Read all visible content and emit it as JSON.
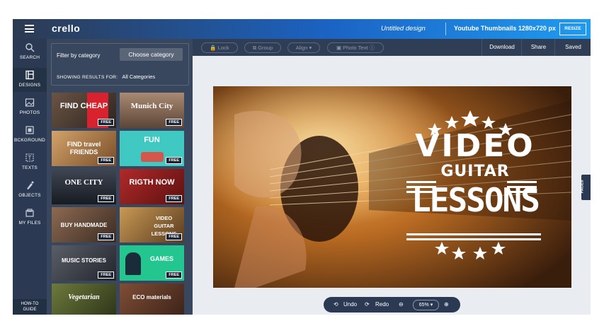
{
  "header": {
    "logo": "crello",
    "design_title": "Untitled design",
    "design_size": "Youtube Thumbnails 1280x720 px",
    "resize_label": "RESIZE"
  },
  "rail": [
    {
      "label": "SEARCH",
      "icon": "search-icon"
    },
    {
      "label": "DESIGNS",
      "icon": "designs-icon"
    },
    {
      "label": "PHOTOS",
      "icon": "photos-icon"
    },
    {
      "label": "BCKGROUND",
      "icon": "background-icon"
    },
    {
      "label": "TEXTS",
      "icon": "texts-icon"
    },
    {
      "label": "OBJECTS",
      "icon": "objects-icon"
    },
    {
      "label": "MY FILES",
      "icon": "files-icon"
    }
  ],
  "howto": {
    "line1": "HOW-TO",
    "line2": "GUIDE"
  },
  "panel": {
    "filter_label": "Filter by category",
    "choose_button": "Choose category",
    "showing_label": "SHOWING RESULTS FOR:",
    "showing_value": "All Categories"
  },
  "templates": [
    {
      "title": "FIND CHEAP",
      "badge": "FREE"
    },
    {
      "title": "Munich City",
      "badge": "FREE"
    },
    {
      "title": "FIND travel FRIENDS",
      "badge": "FREE"
    },
    {
      "title": "FUN",
      "badge": "FREE"
    },
    {
      "title": "ONE CITY",
      "badge": "FREE"
    },
    {
      "title": "RIGTH NOW",
      "badge": "FREE"
    },
    {
      "title": "BUY HANDMADE",
      "badge": "FREE"
    },
    {
      "title": "VIDEO GUITAR LESSONS",
      "badge": "FREE"
    },
    {
      "title": "MUSIC STORIES",
      "badge": "FREE"
    },
    {
      "title": "GAMES",
      "badge": "FREE"
    },
    {
      "title": "Vegetarian",
      "badge": ""
    },
    {
      "title": "ECO materials",
      "badge": ""
    }
  ],
  "toolbar": {
    "lock": "Lock",
    "group": "Group",
    "align": "Align",
    "photo_text": "Photo Text",
    "download": "Download",
    "share": "Share",
    "saved": "Saved"
  },
  "canvas": {
    "line1": "VIDEO",
    "line2": "GUITAR",
    "line3": "LESSONS"
  },
  "pages_tab": "PAGES",
  "bottom": {
    "undo": "Undo",
    "redo": "Redo",
    "zoom": "65%"
  },
  "colors": {
    "accent": "#1f9bf0",
    "dark": "#2b3a52"
  }
}
